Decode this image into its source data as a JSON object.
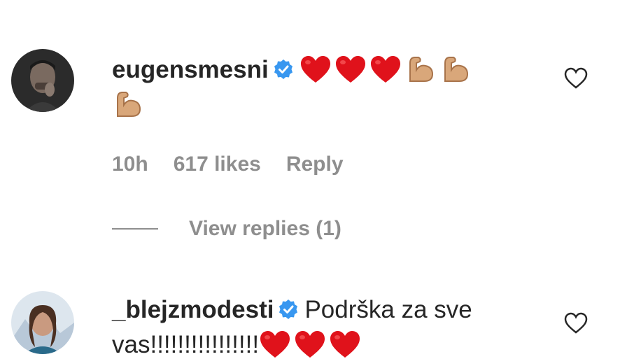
{
  "comments": [
    {
      "username": "eugensmesni",
      "verified": true,
      "text": "",
      "emojis": [
        "heart",
        "heart",
        "heart",
        "flexed-biceps",
        "flexed-biceps",
        "flexed-biceps"
      ],
      "time": "10h",
      "likes": "617 likes",
      "reply_label": "Reply",
      "view_replies": "View replies (1)"
    },
    {
      "username": "_blejzmodesti",
      "verified": true,
      "text": "Podrška za sve vas!!!!!!!!!!!!!!!!",
      "emojis": [
        "heart",
        "heart",
        "heart"
      ]
    }
  ],
  "colors": {
    "text": "#262626",
    "secondary": "#8e8e8e",
    "verified": "#3897f0",
    "heart_emoji": "#e0121b",
    "biceps": "#d9a77a"
  }
}
